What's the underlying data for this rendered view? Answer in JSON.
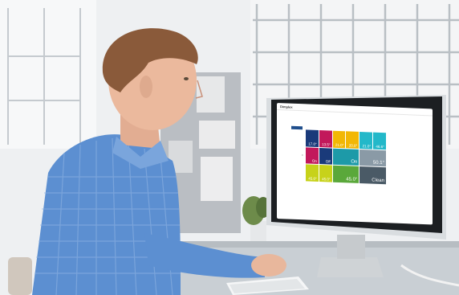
{
  "screen": {
    "app_title": "Dimplex",
    "menu": [
      "",
      "",
      ""
    ],
    "tabs": [
      "",
      "",
      "",
      "",
      ""
    ],
    "sidebar_items": [
      "",
      "",
      "",
      "",
      "",
      "",
      "",
      "",
      "",
      "",
      "",
      "",
      "",
      "",
      "",
      ""
    ],
    "tiles": [
      {
        "value": "17.0°",
        "color": "#1a3a7a",
        "span": 1
      },
      {
        "value": "13.5°",
        "color": "#c2185b",
        "span": 1
      },
      {
        "value": "21.0°",
        "color": "#f2b705",
        "span": 1
      },
      {
        "value": "20.0°",
        "color": "#f2b705",
        "span": 1
      },
      {
        "value": "21.0°",
        "color": "#23b8c9",
        "span": 1
      },
      {
        "value": "46.6°",
        "color": "#23b8c9",
        "span": 1
      },
      {
        "value": "On",
        "color": "#c2185b",
        "span": 1
      },
      {
        "value": "Off",
        "color": "#1a3a7a",
        "span": 1
      },
      {
        "value": "On",
        "color": "#1d9aa8",
        "span": 2
      },
      {
        "value": "50.1°",
        "color": "#8a9aa6",
        "span": 2
      },
      {
        "value": "45.0°",
        "color": "#c7d21a",
        "span": 1
      },
      {
        "value": "45.0°",
        "color": "#c7d21a",
        "span": 1
      },
      {
        "value": "45.0°",
        "color": "#5aa83a",
        "span": 2
      },
      {
        "value": "Clean",
        "color": "#4a5a66",
        "span": 2
      }
    ]
  },
  "colors": {
    "wall": "#eef0f2",
    "shirt": "#5c8fd1",
    "desk": "#c9cfd4",
    "monitor_frame": "#1c1f22",
    "monitor_body": "#d9dde0"
  }
}
